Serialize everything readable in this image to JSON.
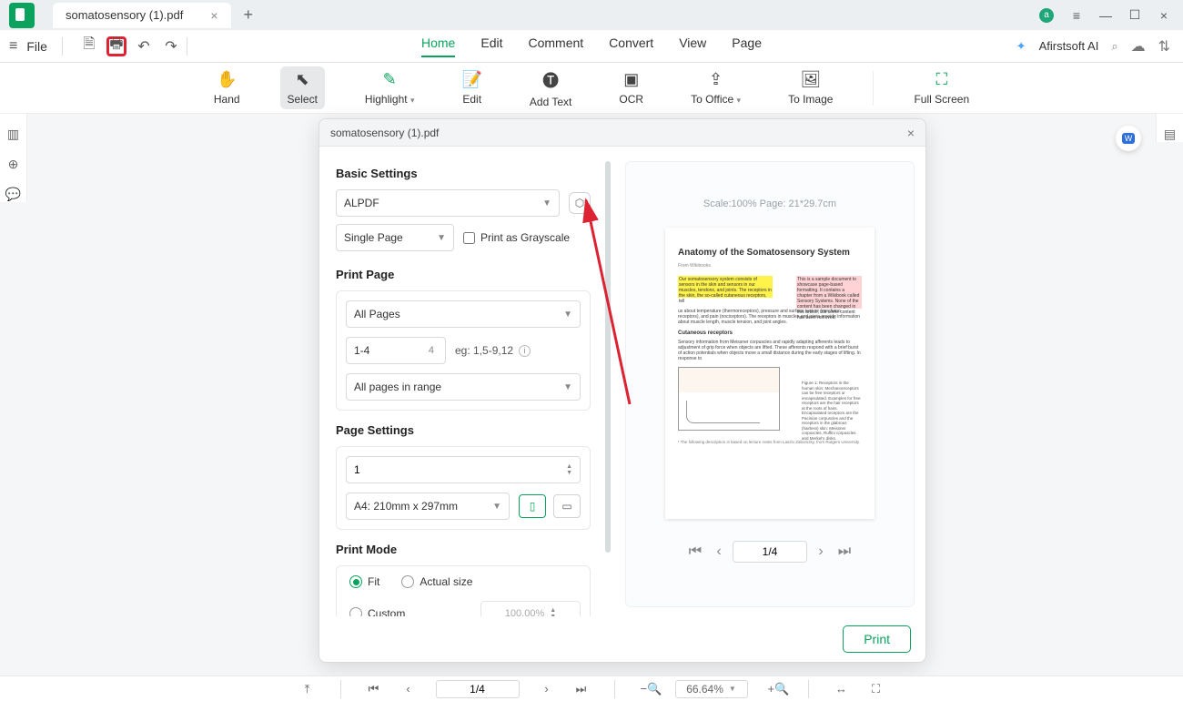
{
  "app": {
    "tab_title": "somatosensory (1).pdf",
    "avatar_letter": "a"
  },
  "file_menu": {
    "label": "File"
  },
  "main_tabs": {
    "home": "Home",
    "edit": "Edit",
    "comment": "Comment",
    "convert": "Convert",
    "view": "View",
    "page": "Page"
  },
  "ai_label": "Afirstsoft AI",
  "toolbar": {
    "hand": "Hand",
    "select": "Select",
    "highlight": "Highlight",
    "edit": "Edit",
    "addtext": "Add Text",
    "ocr": "OCR",
    "tooffice": "To Office",
    "toimage": "To Image",
    "fullscreen": "Full Screen"
  },
  "dialog": {
    "title": "somatosensory (1).pdf",
    "sections": {
      "basic": "Basic Settings",
      "printpage": "Print Page",
      "pagesettings": "Page Settings",
      "printmode": "Print Mode"
    },
    "printer": "ALPDF",
    "layout": "Single Page",
    "grayscale_label": "Print as Grayscale",
    "range_select": "All Pages",
    "range_value": "1-4",
    "range_total": "4",
    "range_hint": "eg: 1,5-9,12",
    "range_filter": "All pages in range",
    "copies": "1",
    "papersize": "A4: 210mm x 297mm",
    "mode_fit": "Fit",
    "mode_actual": "Actual size",
    "mode_custom": "Custom",
    "custom_pct": "100.00%",
    "preview_info": "Scale:100%  Page: 21*29.7cm",
    "nav_value": "1/4",
    "print_btn": "Print",
    "doc": {
      "title": "Anatomy of the Somatosensory System",
      "source": "From Wikibooks",
      "hl_yellow": "Our somatosensory system consists of sensors in the skin and sensors in our muscles, tendons, and joints. The receptors in the skin, the so-called cutaneous receptors, tell",
      "hl_pink": "This is a sample document to showcase page-based formatting. It contains a chapter from a Wikibook called Sensory Systems. None of the content has been changed in this article, but some content has been removed.",
      "para1": "us about temperature (thermoreceptors), pressure and surface texture (mechano receptors), and pain (nociceptors). The receptors in muscles and joints provide information about muscle length, muscle tension, and joint angles.",
      "sub": "Cutaneous receptors",
      "para2": "Sensory information from Meissner corpuscles and rapidly adapting afferents leads to adjustment of grip force when objects are lifted. These afferents respond with a brief burst of action potentials when objects move a small distance during the early stages of lifting. In response to",
      "figcap": "Figure 1: Receptors in the human skin: Mechanoreceptors can be free receptors or encapsulated. Examples for free receptors are the hair receptors at the roots of hairs. Encapsulated receptors are the Pacinian corpuscles and the receptors in the glabrous (hairless) skin: Meissner corpuscles, Ruffini corpuscles and Merkel's disks.",
      "footnote": "¹ The following description is based on lecture notes from Laszlo Zaborszky, from Rutgers University."
    }
  },
  "statusbar": {
    "page": "1/4",
    "zoom": "66.64%"
  }
}
